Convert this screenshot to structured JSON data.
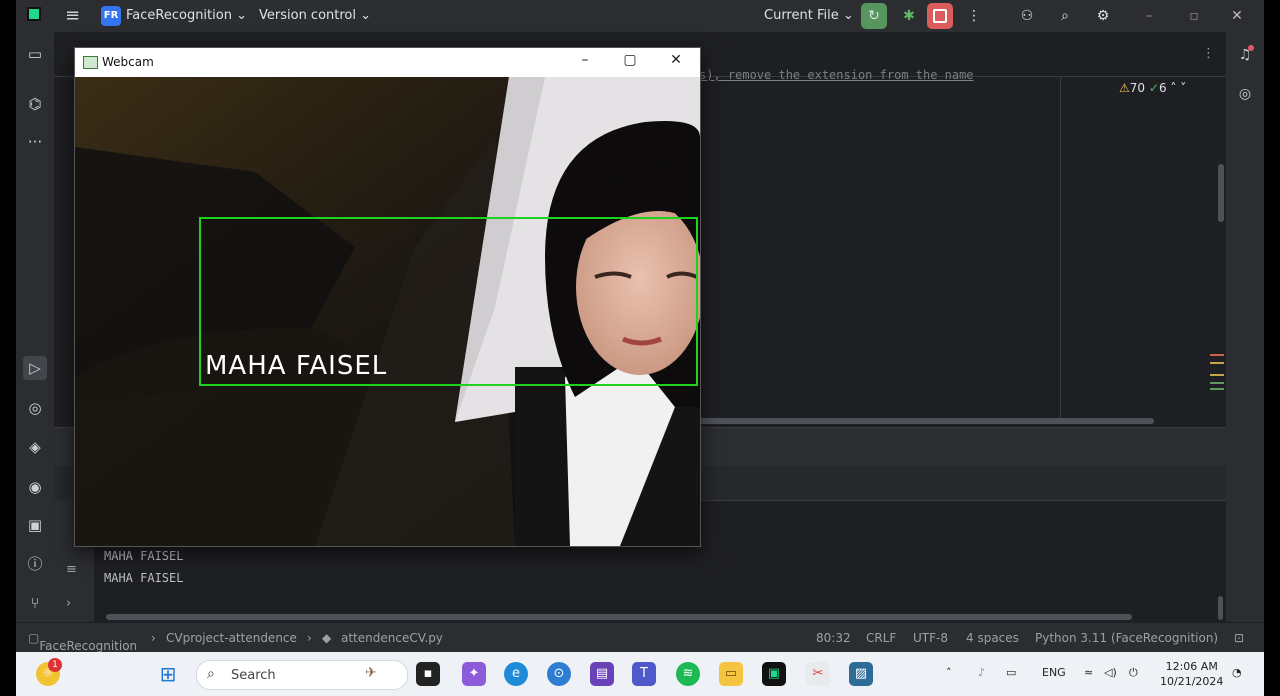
{
  "ide": {
    "project_badge": "FR",
    "project_name": "FaceRecognition",
    "version_control": "Version control",
    "run_config": "Current File",
    "code_line": "s), remove the extension from the name",
    "warnings": "70",
    "weak_warnings": "6"
  },
  "webcam_window": {
    "title": "Webcam",
    "detected_name": "MAHA FAISEL"
  },
  "run_output": {
    "lines": [
      "MAHA FAISEL",
      "MAHA FAISEL"
    ]
  },
  "statusbar": {
    "breadcrumb_project": "FaceRecognition",
    "breadcrumb_folder": "CVproject-attendence",
    "breadcrumb_file": "attendenceCV.py",
    "position": "80:32",
    "line_ending": "CRLF",
    "encoding": "UTF-8",
    "indent": "4 spaces",
    "interpreter": "Python 3.11 (FaceRecognition)"
  },
  "taskbar": {
    "search_placeholder": "Search",
    "notification_count": "1",
    "language": "ENG",
    "time": "12:06 AM",
    "date": "10/21/2024"
  },
  "colors": {
    "ide_bg": "#1e1f22",
    "ide_panel": "#2b2d30",
    "run_green": "#57965c",
    "stop_red": "#db5c5c",
    "detect_box": "#1ed21e"
  }
}
